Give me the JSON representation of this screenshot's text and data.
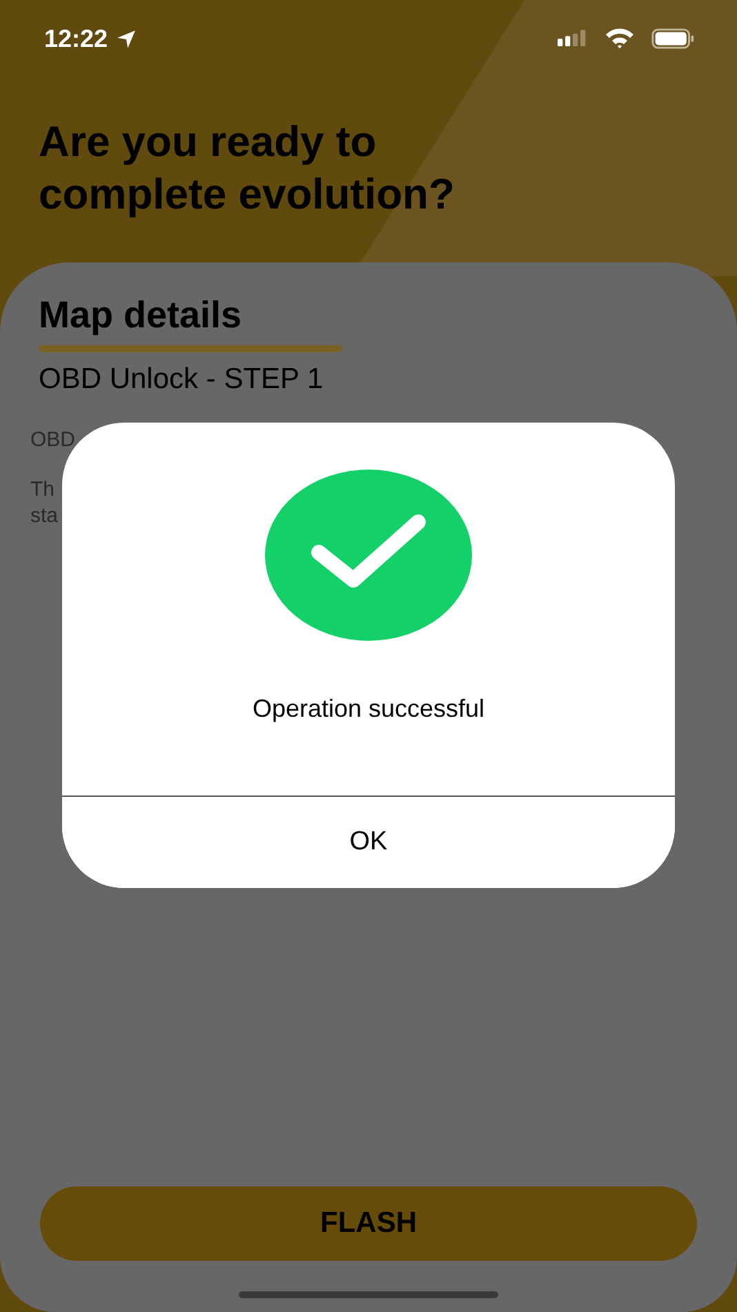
{
  "status_bar": {
    "time": "12:22"
  },
  "title": "Are you ready to complete evolution?",
  "card": {
    "heading": "Map details",
    "subtitle": "OBD Unlock - STEP 1",
    "partial_label": "OBD",
    "partial_description": [
      "Th",
      "sta"
    ]
  },
  "flash_button": {
    "label": "FLASH"
  },
  "dialog": {
    "message": "Operation successful",
    "button": "OK"
  }
}
